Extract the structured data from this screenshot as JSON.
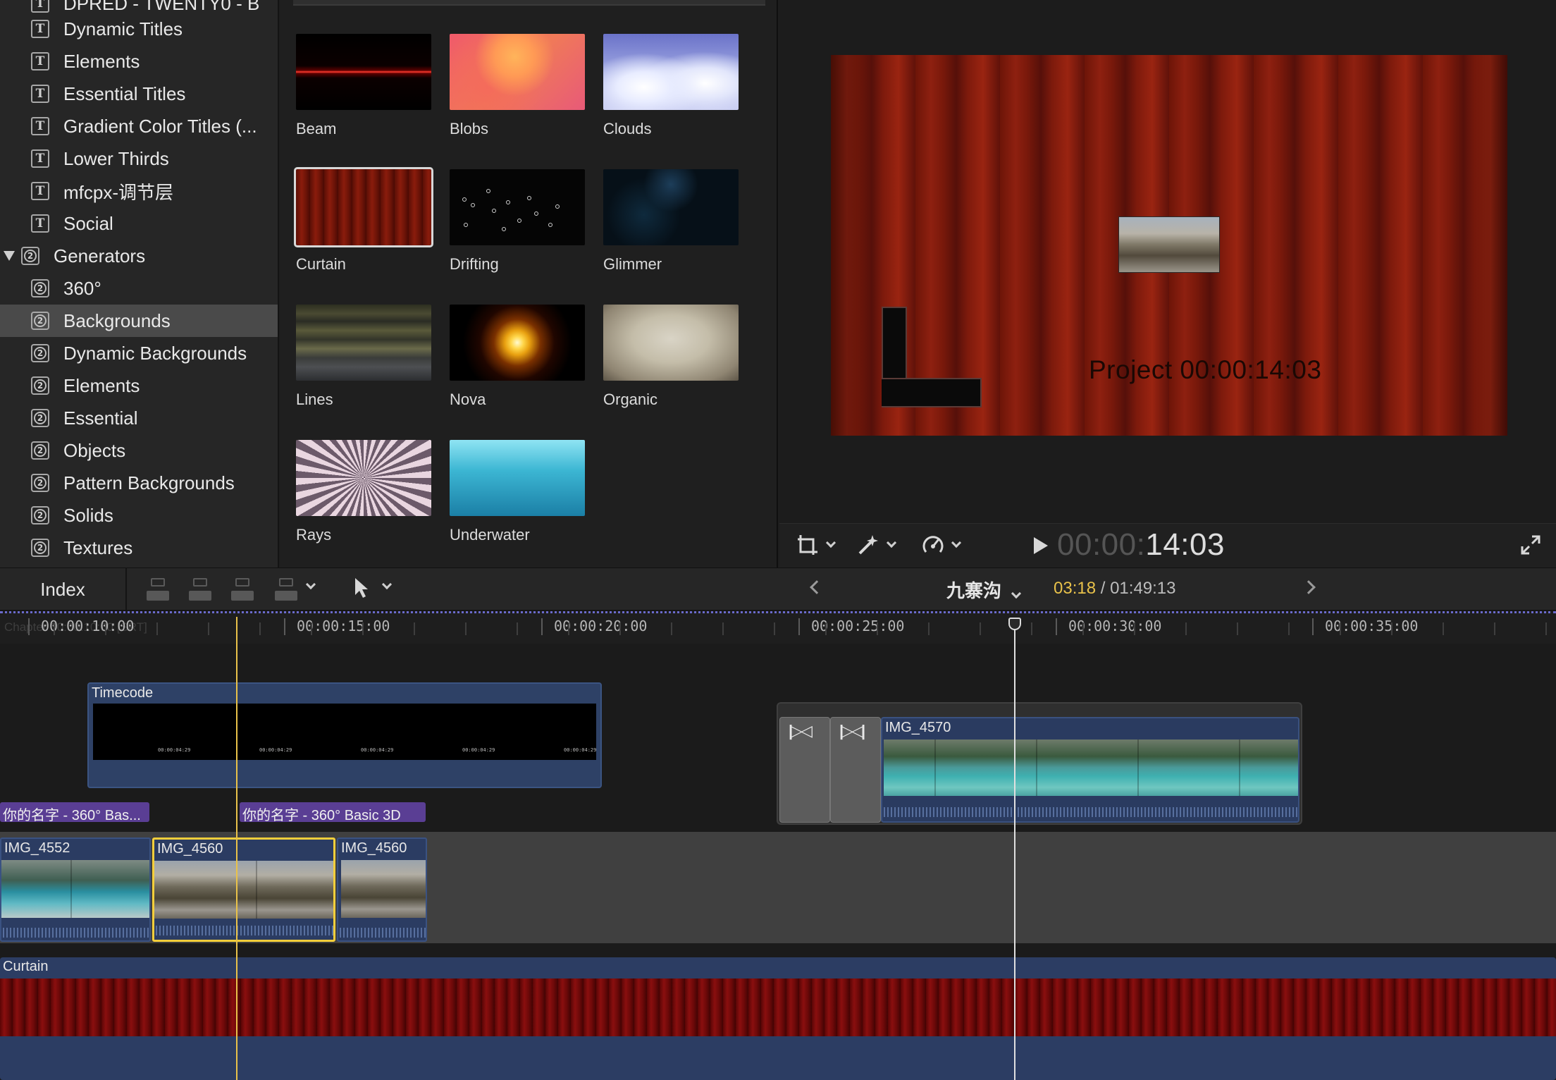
{
  "sidebar": {
    "partial_top_label": "DPRED - TWENTY0 - B",
    "items": [
      {
        "label": "Dynamic Titles",
        "kind": "title"
      },
      {
        "label": "Elements",
        "kind": "title"
      },
      {
        "label": "Essential Titles",
        "kind": "title"
      },
      {
        "label": "Gradient Color Titles (...",
        "kind": "title"
      },
      {
        "label": "Lower Thirds",
        "kind": "title"
      },
      {
        "label": "mfcpx-调节层",
        "kind": "title"
      },
      {
        "label": "Social",
        "kind": "title"
      },
      {
        "label": "Generators",
        "kind": "group"
      },
      {
        "label": "360°",
        "kind": "generator"
      },
      {
        "label": "Backgrounds",
        "kind": "generator",
        "selected": true
      },
      {
        "label": "Dynamic Backgrounds",
        "kind": "generator"
      },
      {
        "label": "Elements",
        "kind": "generator"
      },
      {
        "label": "Essential",
        "kind": "generator"
      },
      {
        "label": "Objects",
        "kind": "generator"
      },
      {
        "label": "Pattern Backgrounds",
        "kind": "generator"
      },
      {
        "label": "Solids",
        "kind": "generator"
      },
      {
        "label": "Textures",
        "kind": "generator"
      }
    ],
    "title_icon_glyph": "T",
    "generator_icon_glyph": "2"
  },
  "browser": {
    "thumbnails": [
      {
        "label": "Beam",
        "style": "t-beam"
      },
      {
        "label": "Blobs",
        "style": "t-blobs"
      },
      {
        "label": "Clouds",
        "style": "t-clouds"
      },
      {
        "label": "Curtain",
        "style": "t-curtain",
        "selected": true
      },
      {
        "label": "Drifting",
        "style": "t-drifting"
      },
      {
        "label": "Glimmer",
        "style": "t-glimmer"
      },
      {
        "label": "Lines",
        "style": "t-lines"
      },
      {
        "label": "Nova",
        "style": "t-nova"
      },
      {
        "label": "Organic",
        "style": "t-organic"
      },
      {
        "label": "Rays",
        "style": "t-rays"
      },
      {
        "label": "Underwater",
        "style": "t-underwater"
      }
    ]
  },
  "viewer": {
    "canvas_text": "Project 00:00:14:03",
    "timecode_dim": "00:00:",
    "timecode_lit": "14:03"
  },
  "timeline": {
    "index_label": "Index",
    "project_name": "九寨沟",
    "current_time": "03:18",
    "separator": " / ",
    "total_time": "01:49:13",
    "ruler_ghost_text": "Chapter 00:00:10:00 [SRT]",
    "ruler_labels": [
      "00:00:10:00",
      "00:00:15:00",
      "00:00:20:00",
      "00:00:25:00",
      "00:00:30:00",
      "00:00:35:00"
    ],
    "clips": {
      "timecode_title": "Timecode",
      "timecode_mini": "00:00:04:29",
      "img4570": "IMG_4570",
      "title_tag_1": "你的名字 - 360° Bas...",
      "title_tag_2": "你的名字 - 360° Basic 3D",
      "primary": [
        "IMG_4552",
        "IMG_4560",
        "IMG_4560"
      ],
      "background": "Curtain"
    }
  },
  "colors": {
    "accent_yellow": "#e9c24a",
    "selection_yellow": "#f5cf3b",
    "title_purple": "#5a3e94",
    "clip_blue": "#2b3c62"
  }
}
